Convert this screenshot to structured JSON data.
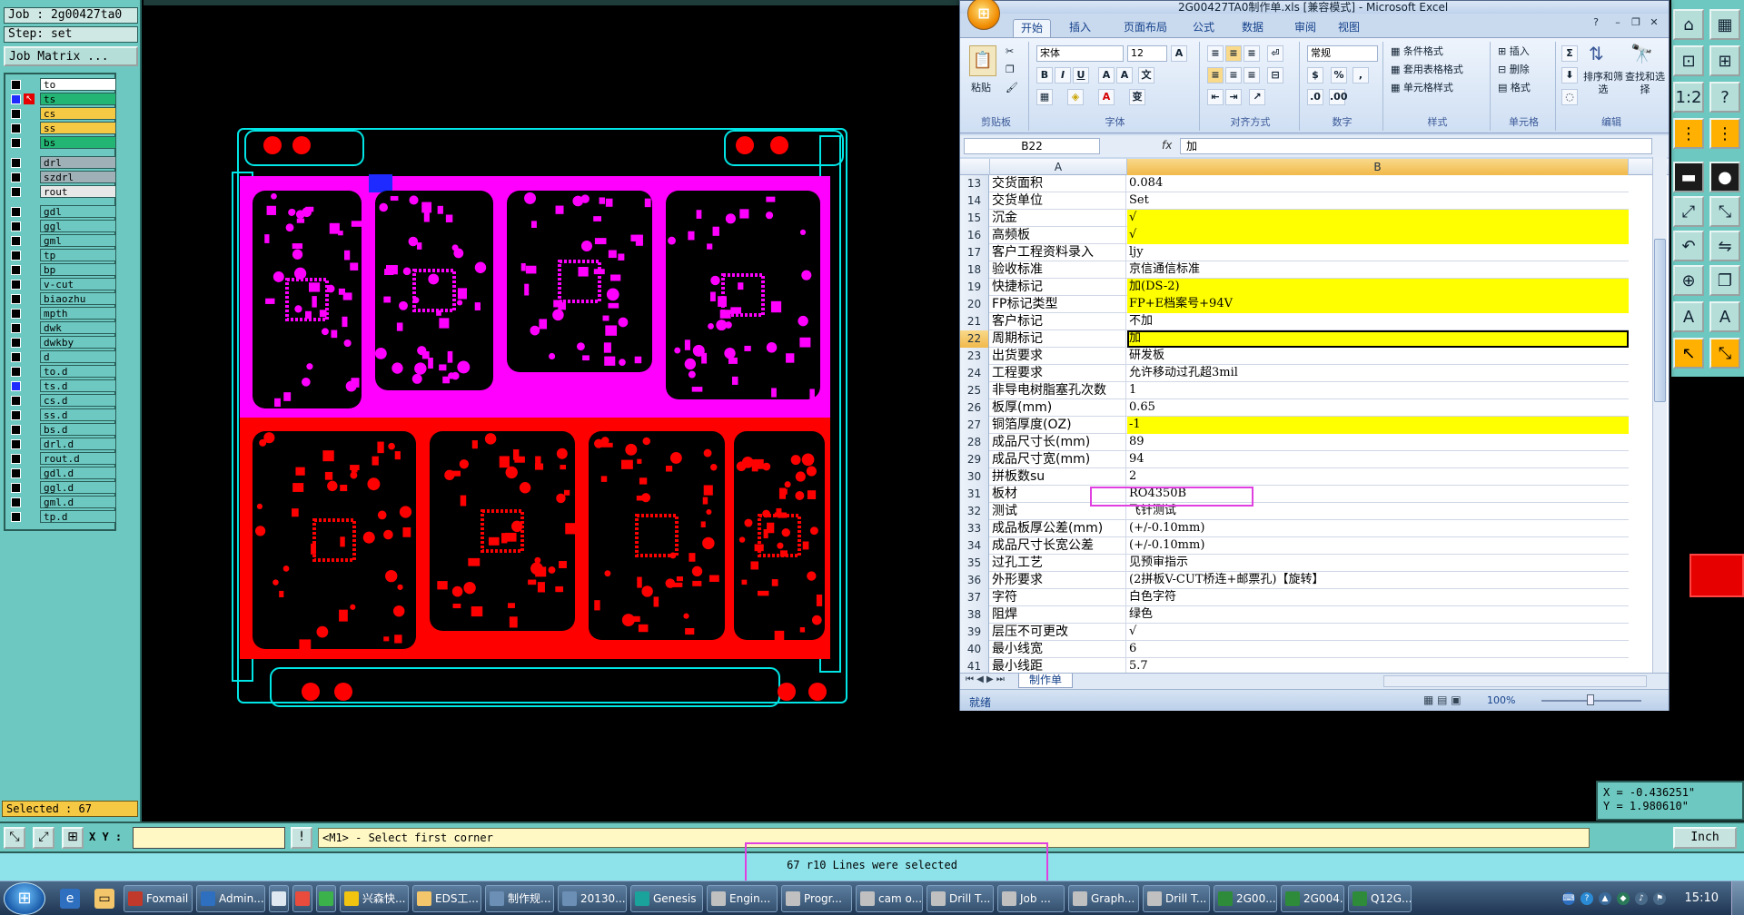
{
  "genesis": {
    "job_label": "Job : 2g00427ta0",
    "step_label": "Step: set",
    "job_matrix_btn": "Job Matrix ...",
    "layers": [
      {
        "name": "to",
        "color": "#ffffff",
        "checked": false
      },
      {
        "name": "ts",
        "color": "#22b573",
        "checked": true,
        "arrow": "a"
      },
      {
        "name": "cs",
        "color": "#f6c945",
        "checked": false
      },
      {
        "name": "ss",
        "color": "#f6c945",
        "checked": false
      },
      {
        "name": "bs",
        "color": "#22b573",
        "checked": false
      },
      {
        "name": "drl",
        "color": "#9fb0b6",
        "checked": false
      },
      {
        "name": "szdrl",
        "color": "#9fb0b6",
        "checked": false
      },
      {
        "name": "rout",
        "color": "#e8e8e8",
        "checked": false
      },
      {
        "name": "gdl",
        "color": "#6cc8c0",
        "checked": false
      },
      {
        "name": "ggl",
        "color": "#6cc8c0",
        "checked": false
      },
      {
        "name": "gml",
        "color": "#6cc8c0",
        "checked": false
      },
      {
        "name": "tp",
        "color": "#6cc8c0",
        "checked": false
      },
      {
        "name": "bp",
        "color": "#6cc8c0",
        "checked": false
      },
      {
        "name": "v-cut",
        "color": "#6cc8c0",
        "checked": false
      },
      {
        "name": "biaozhu",
        "color": "#6cc8c0",
        "checked": false
      },
      {
        "name": "mpth",
        "color": "#6cc8c0",
        "checked": false
      },
      {
        "name": "dwk",
        "color": "#6cc8c0",
        "checked": false
      },
      {
        "name": "dwkby",
        "color": "#6cc8c0",
        "checked": false
      },
      {
        "name": "d",
        "color": "#6cc8c0",
        "checked": false
      },
      {
        "name": "to.d",
        "color": "#6cc8c0",
        "checked": false,
        "arrow": "⬋"
      },
      {
        "name": "ts.d",
        "color": "#6cc8c0",
        "checked": true,
        "arrow": "⬋"
      },
      {
        "name": "cs.d",
        "color": "#6cc8c0",
        "checked": false,
        "arrow": "⬋"
      },
      {
        "name": "ss.d",
        "color": "#6cc8c0",
        "checked": false,
        "arrow": "⬋"
      },
      {
        "name": "bs.d",
        "color": "#6cc8c0",
        "checked": false,
        "arrow": "⬋"
      },
      {
        "name": "drl.d",
        "color": "#6cc8c0",
        "checked": false
      },
      {
        "name": "rout.d",
        "color": "#6cc8c0",
        "checked": false
      },
      {
        "name": "gdl.d",
        "color": "#6cc8c0",
        "checked": false
      },
      {
        "name": "ggl.d",
        "color": "#6cc8c0",
        "checked": false
      },
      {
        "name": "gml.d",
        "color": "#6cc8c0",
        "checked": false,
        "arrow": "⬋"
      },
      {
        "name": "tp.d",
        "color": "#6cc8c0",
        "checked": false,
        "arrow": "⬋"
      }
    ],
    "selected_label": "Selected : 67",
    "xy_label": "X Y :",
    "xy_value": "",
    "command_prompt": "<M1> - Select first corner",
    "status_message": "67 r10 Lines were selected",
    "units_btn": "Inch",
    "coord_x": "X = -0.436251\"",
    "coord_y": "Y = 1.980610\"",
    "pcb_colors": {
      "top_board": "#ff00ff",
      "bottom_board": "#ff0000",
      "outline": "#00e5e5"
    }
  },
  "excel": {
    "title": "2G00427TA0制作单.xls [兼容模式] - Microsoft Excel",
    "tabs": [
      "开始",
      "插入",
      "页面布局",
      "公式",
      "数据",
      "审阅",
      "视图"
    ],
    "active_tab": 0,
    "ribbon": {
      "paste": "粘贴",
      "clipboard": "剪贴板",
      "font_name": "宋体",
      "font_size": "12",
      "font": "字体",
      "align": "对齐方式",
      "number_format": "常规",
      "number": "数字",
      "cond_format": "条件格式",
      "table_format": "套用表格格式",
      "cell_style": "单元格样式",
      "styles": "样式",
      "insert": "插入",
      "delete": "删除",
      "format": "格式",
      "cells": "单元格",
      "sort_filter": "排序和筛选",
      "find_select": "查找和选择",
      "editing": "编辑"
    },
    "name_box": "B22",
    "formula_value": "加",
    "col_headers": [
      "A",
      "B"
    ],
    "rows": [
      {
        "n": "13",
        "a": "交货面积",
        "b": "0.084",
        "y": false
      },
      {
        "n": "14",
        "a": "交货单位",
        "b": "Set",
        "y": false
      },
      {
        "n": "15",
        "a": "沉金",
        "b": "√",
        "y": true
      },
      {
        "n": "16",
        "a": "高频板",
        "b": "√",
        "y": true
      },
      {
        "n": "17",
        "a": "客户工程资料录入",
        "b": "ljy",
        "y": false
      },
      {
        "n": "18",
        "a": "验收标准",
        "b": "京信通信标准",
        "y": false
      },
      {
        "n": "19",
        "a": "快捷标记",
        "b": "加(DS-2)",
        "y": true
      },
      {
        "n": "20",
        "a": "FP标记类型",
        "b": "FP+E档案号+94V",
        "y": true
      },
      {
        "n": "21",
        "a": "客户标记",
        "b": "不加",
        "y": false
      },
      {
        "n": "22",
        "a": "周期标记",
        "b": "加",
        "y": true,
        "active": true
      },
      {
        "n": "23",
        "a": "出货要求",
        "b": "研发板",
        "y": false
      },
      {
        "n": "24",
        "a": "工程要求",
        "b": "允许移动过孔超3mil",
        "y": false
      },
      {
        "n": "25",
        "a": "非导电树脂塞孔次数",
        "b": "1",
        "y": false
      },
      {
        "n": "26",
        "a": "板厚(mm)",
        "b": "0.65",
        "y": false
      },
      {
        "n": "27",
        "a": "铜箔厚度(OZ)",
        "b": "-1",
        "y": true
      },
      {
        "n": "28",
        "a": "成品尺寸长(mm)",
        "b": "89",
        "y": false
      },
      {
        "n": "29",
        "a": "成品尺寸宽(mm)",
        "b": "94",
        "y": false
      },
      {
        "n": "30",
        "a": "拼板数su",
        "b": "2",
        "y": false
      },
      {
        "n": "31",
        "a": "板材",
        "b": "RO4350B",
        "y": false
      },
      {
        "n": "32",
        "a": "测试",
        "b": "飞针测试",
        "y": false
      },
      {
        "n": "33",
        "a": "成品板厚公差(mm)",
        "b": "(+/-0.10mm)",
        "y": false
      },
      {
        "n": "34",
        "a": "成品尺寸长宽公差",
        "b": "(+/-0.10mm)",
        "y": false
      },
      {
        "n": "35",
        "a": "过孔工艺",
        "b": "见预审指示",
        "y": false
      },
      {
        "n": "36",
        "a": "外形要求",
        "b": "(2拼板V-CUT桥连+邮票孔)【旋转】",
        "y": false
      },
      {
        "n": "37",
        "a": "字符",
        "b": "白色字符",
        "y": false
      },
      {
        "n": "38",
        "a": "阻焊",
        "b": "绿色",
        "y": false
      },
      {
        "n": "39",
        "a": "层压不可更改",
        "b": "√",
        "y": false
      },
      {
        "n": "40",
        "a": "最小线宽",
        "b": "6",
        "y": false
      },
      {
        "n": "41",
        "a": "最小线距",
        "b": "5.7",
        "y": false
      }
    ],
    "sheet_tab": "制作单",
    "status_ready": "就绪",
    "zoom": "100%"
  },
  "taskbar": {
    "items": [
      {
        "label": "Foxmail",
        "icon": "mail-icon",
        "color": "#c0392b"
      },
      {
        "label": "Admin...",
        "icon": "admin-icon",
        "color": "#2e6fc0"
      },
      {
        "label": "",
        "icon": "doc-icon",
        "color": "#dfe8f0"
      },
      {
        "label": "",
        "icon": "app-icon",
        "color": "#e94b3c"
      },
      {
        "label": "",
        "icon": "green-icon",
        "color": "#3bb34a"
      },
      {
        "label": "兴森快...",
        "icon": "star-icon",
        "color": "#f1c40f"
      },
      {
        "label": "EDS工...",
        "icon": "folder-icon",
        "color": "#f3c66b"
      },
      {
        "label": "制作规...",
        "icon": "window-icon",
        "color": "#6b8fb5"
      },
      {
        "label": "20130...",
        "icon": "window-icon",
        "color": "#6b8fb5"
      },
      {
        "label": "Genesis",
        "icon": "genesis-icon",
        "color": "#1aa39a"
      },
      {
        "label": "Engin...",
        "icon": "x-icon",
        "color": "#c0c0c0"
      },
      {
        "label": "Progr...",
        "icon": "x-icon",
        "color": "#c0c0c0"
      },
      {
        "label": "cam o...",
        "icon": "x-icon",
        "color": "#c0c0c0"
      },
      {
        "label": "Drill T...",
        "icon": "x-icon",
        "color": "#c0c0c0"
      },
      {
        "label": "Job ...",
        "icon": "x-icon",
        "color": "#c0c0c0"
      },
      {
        "label": "Graph...",
        "icon": "x-icon",
        "color": "#c0c0c0"
      },
      {
        "label": "Drill T...",
        "icon": "x-icon",
        "color": "#c0c0c0"
      },
      {
        "label": "2G00...",
        "icon": "excel-icon",
        "color": "#2e8b3a"
      },
      {
        "label": "2G004...",
        "icon": "excel-icon",
        "color": "#2e8b3a"
      },
      {
        "label": "Q12G...",
        "icon": "excel-icon",
        "color": "#2e8b3a"
      }
    ],
    "clock": "15:10"
  }
}
